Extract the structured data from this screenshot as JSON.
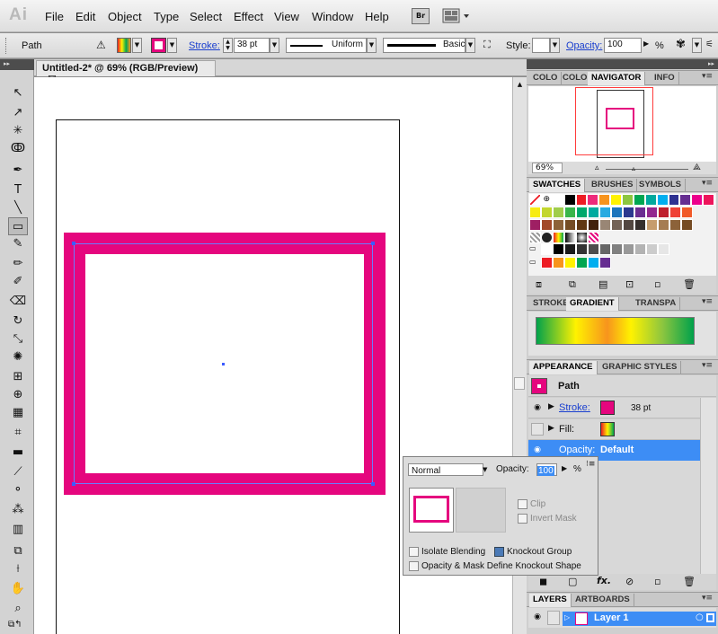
{
  "menubar": {
    "logo": "Ai",
    "items": [
      "File",
      "Edit",
      "Object",
      "Type",
      "Select",
      "Effect",
      "View",
      "Window",
      "Help"
    ],
    "bridge_label": "Br"
  },
  "control": {
    "selection_type": "Path",
    "stroke_label": "Stroke:",
    "stroke_weight": "38 pt",
    "profile_label": "Uniform",
    "brush_label": "Basic",
    "style_label": "Style:",
    "opacity_label": "Opacity:",
    "opacity_value": "100",
    "percent": "%"
  },
  "document": {
    "tab_title": "Untitled-2* @ 69% (RGB/Preview)",
    "close_glyph": "☒"
  },
  "colors": {
    "stroke": "#e5067e",
    "selection": "#3b5bff",
    "panel_highlight": "#3d8df5"
  },
  "tools": [
    {
      "icon": "selection-arrow-icon",
      "glyph": "↖"
    },
    {
      "icon": "direct-selection-icon",
      "glyph": "↗"
    },
    {
      "icon": "magic-wand-icon",
      "glyph": "✳"
    },
    {
      "icon": "lasso-icon",
      "glyph": "ↂ"
    },
    {
      "icon": "pen-icon",
      "glyph": "✒"
    },
    {
      "icon": "type-icon",
      "glyph": "T"
    },
    {
      "icon": "line-icon",
      "glyph": "╲"
    },
    {
      "icon": "rectangle-icon",
      "glyph": "▭"
    },
    {
      "icon": "paintbrush-icon",
      "glyph": "✎"
    },
    {
      "icon": "pencil-icon",
      "glyph": "✏"
    },
    {
      "icon": "blob-brush-icon",
      "glyph": "✐"
    },
    {
      "icon": "eraser-icon",
      "glyph": "⌫"
    },
    {
      "icon": "rotate-icon",
      "glyph": "↻"
    },
    {
      "icon": "scale-icon",
      "glyph": "⤡"
    },
    {
      "icon": "warp-icon",
      "glyph": "✺"
    },
    {
      "icon": "free-transform-icon",
      "glyph": "⊞"
    },
    {
      "icon": "shape-builder-icon",
      "glyph": "⊕"
    },
    {
      "icon": "perspective-grid-icon",
      "glyph": "▦"
    },
    {
      "icon": "mesh-icon",
      "glyph": "⌗"
    },
    {
      "icon": "gradient-icon",
      "glyph": "▬"
    },
    {
      "icon": "eyedropper-icon",
      "glyph": "⟋"
    },
    {
      "icon": "blend-icon",
      "glyph": "⚬"
    },
    {
      "icon": "symbol-sprayer-icon",
      "glyph": "⁂"
    },
    {
      "icon": "column-graph-icon",
      "glyph": "▥"
    },
    {
      "icon": "artboard-icon",
      "glyph": "⧉"
    },
    {
      "icon": "slice-icon",
      "glyph": "⟊"
    },
    {
      "icon": "hand-icon",
      "glyph": "✋"
    },
    {
      "icon": "zoom-icon",
      "glyph": "⌕"
    }
  ],
  "navigator": {
    "tabs": [
      "COLO",
      "COLO",
      "NAVIGATOR",
      "INFO"
    ],
    "zoom": "69%"
  },
  "swatches": {
    "tabs": [
      "SWATCHES",
      "BRUSHES",
      "SYMBOLS"
    ],
    "row1": [
      "#ffffff",
      "#000000",
      "#ed1c24",
      "#ee2a7b",
      "#f7941d",
      "#fff200",
      "#8dc63f",
      "#00a651",
      "#00a99d",
      "#00aeef",
      "#2e3192",
      "#662d91",
      "#ec008c",
      "#ed145b",
      "#f26522",
      "#fbb040"
    ],
    "row2": [
      "#f7ec13",
      "#c2d62e",
      "#a0cd4b",
      "#39b54a",
      "#00a86b",
      "#00aa9f",
      "#27aae1",
      "#1c75bc",
      "#2b388f",
      "#6b2c91",
      "#92278f",
      "#be1e2d",
      "#ef4136",
      "#f15a29"
    ],
    "row3": [
      "#9e1f63",
      "#a24928",
      "#8c6239",
      "#754c24",
      "#603813",
      "#42210b",
      "#998675",
      "#736357",
      "#534741",
      "#362f2d",
      "#c69c6d",
      "#a67c52",
      "#8c6239",
      "#754c24"
    ],
    "gray": [
      "#ffffff",
      "#000000",
      "#1a1a1a",
      "#333333",
      "#4d4d4d",
      "#666666",
      "#808080",
      "#999999",
      "#b3b3b3",
      "#cccccc",
      "#e6e6e6",
      "#f2f2f2"
    ],
    "grp": [
      "#ed1c24",
      "#f7941d",
      "#fff200",
      "#00a651",
      "#00aeef",
      "#662d91"
    ]
  },
  "gradient": {
    "tabs": [
      "STROKE",
      "GRADIENT",
      "TRANSPA"
    ]
  },
  "appearance": {
    "tabs": [
      "APPEARANCE",
      "GRAPHIC STYLES"
    ],
    "title": "Path",
    "stroke_label": "Stroke:",
    "stroke_weight": "38 pt",
    "fill_label": "Fill:",
    "opacity_label": "Opacity:",
    "opacity_value": "Default"
  },
  "transparency_popup": {
    "blend_mode": "Normal",
    "opacity_label": "Opacity:",
    "opacity_value": "100",
    "percent": "%",
    "clip_label": "Clip",
    "invert_mask_label": "Invert Mask",
    "isolate_label": "Isolate Blending",
    "knockout_label": "Knockout Group",
    "opacity_mask_label": "Opacity & Mask Define Knockout Shape"
  },
  "layers": {
    "tabs": [
      "LAYERS",
      "ARTBOARDS"
    ],
    "layer_name": "Layer 1"
  }
}
